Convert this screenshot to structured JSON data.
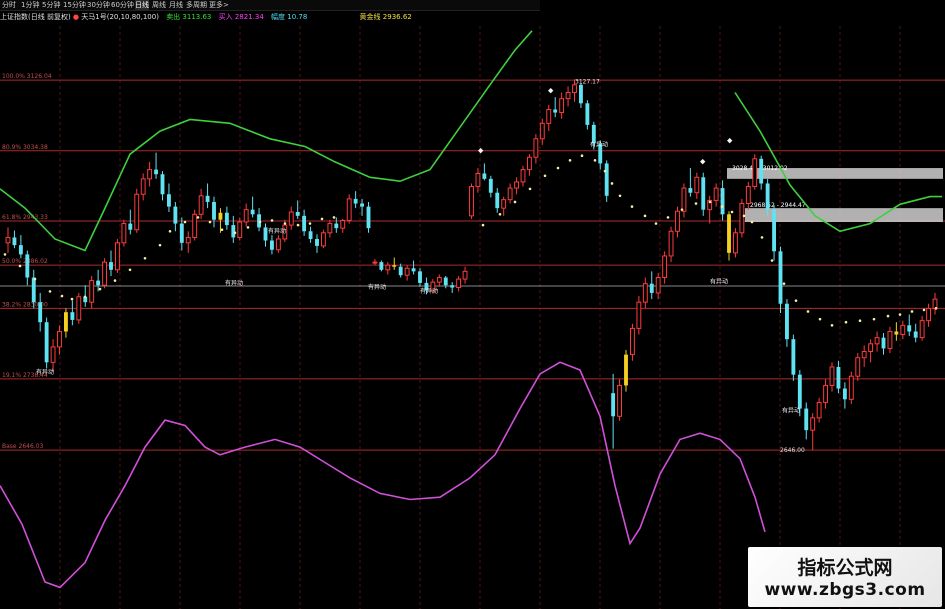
{
  "toolbar": {
    "tabs": [
      "分时",
      "1分钟",
      "5分钟",
      "15分钟",
      "30分钟",
      "60分钟",
      "日线",
      "周线",
      "月线",
      "多周期",
      "更多>"
    ],
    "active": "日线"
  },
  "legend": {
    "instrument": "上证指数(日线 前复权)",
    "indicator": "天马1号(20,10,80,100)",
    "sell_label": "卖出",
    "sell_value": "3113.63",
    "buy_label": "买入",
    "buy_value": "2821.34",
    "amp_label": "幅度",
    "amp_value": "10.78",
    "gold_label": "黄金线",
    "gold_value": "2936.62"
  },
  "levels": [
    {
      "label": "100.0% 3126.04",
      "value": 3126.04
    },
    {
      "label": "80.9% 3034.38",
      "value": 3034.38
    },
    {
      "label": "61.8% 2943.33",
      "value": 2943.33
    },
    {
      "label": "50.0% 2886.02",
      "value": 2886.02
    },
    {
      "label": "38.2% 2830.00",
      "value": 2830.0
    },
    {
      "label": "19.1% 2738.44",
      "value": 2738.44
    },
    {
      "label": "Base 2646.03",
      "value": 2646.03
    }
  ],
  "annotations": {
    "high": "3127.17",
    "low": "2646.00",
    "box_upper": "3028.46 - 3012.02",
    "box_lower": "2968.52 - 2944.47",
    "signal": "有异动"
  },
  "watermark": {
    "title": "指标公式网",
    "url": "www.zbgs3.com"
  },
  "colors": {
    "up": "#ff3b3b",
    "down": "#5fe3f2",
    "flag": "#f5d020",
    "green_band": "#3fcf3f",
    "purple_band": "#d050d8",
    "dots": "#f5f0a0",
    "level": "#c03030",
    "box": "#d0d0d0"
  },
  "chart_data": {
    "type": "candlestick",
    "candles": [
      [
        2915,
        2935,
        2902,
        2922
      ],
      [
        2922,
        2931,
        2908,
        2912
      ],
      [
        2912,
        2925,
        2895,
        2900
      ],
      [
        2900,
        2905,
        2860,
        2870
      ],
      [
        2870,
        2880,
        2830,
        2838
      ],
      [
        2838,
        2850,
        2800,
        2812
      ],
      [
        2812,
        2818,
        2752,
        2760
      ],
      [
        2760,
        2790,
        2748,
        2780
      ],
      [
        2780,
        2808,
        2770,
        2800
      ],
      [
        2800,
        2830,
        2792,
        2825
      ],
      [
        2825,
        2840,
        2808,
        2815
      ],
      [
        2815,
        2850,
        2810,
        2845
      ],
      [
        2845,
        2860,
        2832,
        2838
      ],
      [
        2838,
        2872,
        2830,
        2866
      ],
      [
        2866,
        2880,
        2852,
        2860
      ],
      [
        2860,
        2895,
        2856,
        2890
      ],
      [
        2890,
        2905,
        2872,
        2880
      ],
      [
        2880,
        2920,
        2876,
        2915
      ],
      [
        2915,
        2945,
        2910,
        2940
      ],
      [
        2940,
        2958,
        2926,
        2932
      ],
      [
        2932,
        2985,
        2928,
        2978
      ],
      [
        2978,
        3005,
        2970,
        2998
      ],
      [
        2998,
        3020,
        2988,
        3010
      ],
      [
        3010,
        3032,
        2998,
        3004
      ],
      [
        3004,
        3008,
        2970,
        2978
      ],
      [
        2978,
        2992,
        2955,
        2962
      ],
      [
        2962,
        2968,
        2930,
        2940
      ],
      [
        2940,
        2948,
        2905,
        2915
      ],
      [
        2915,
        2930,
        2902,
        2922
      ],
      [
        2922,
        2958,
        2918,
        2952
      ],
      [
        2952,
        2985,
        2946,
        2976
      ],
      [
        2976,
        2992,
        2960,
        2968
      ],
      [
        2968,
        2975,
        2935,
        2945
      ],
      [
        2945,
        2960,
        2928,
        2954
      ],
      [
        2954,
        2962,
        2932,
        2938
      ],
      [
        2938,
        2950,
        2915,
        2922
      ],
      [
        2922,
        2948,
        2918,
        2942
      ],
      [
        2942,
        2966,
        2936,
        2958
      ],
      [
        2958,
        2975,
        2948,
        2952
      ],
      [
        2952,
        2960,
        2930,
        2935
      ],
      [
        2935,
        2940,
        2910,
        2918
      ],
      [
        2918,
        2925,
        2900,
        2906
      ],
      [
        2906,
        2925,
        2902,
        2920
      ],
      [
        2920,
        2945,
        2916,
        2938
      ],
      [
        2938,
        2962,
        2932,
        2955
      ],
      [
        2955,
        2970,
        2946,
        2950
      ],
      [
        2950,
        2958,
        2924,
        2930
      ],
      [
        2930,
        2936,
        2915,
        2920
      ],
      [
        2920,
        2926,
        2902,
        2911
      ],
      [
        2911,
        2932,
        2908,
        2928
      ],
      [
        2928,
        2945,
        2922,
        2940
      ],
      [
        2940,
        2948,
        2928,
        2934
      ],
      [
        2934,
        2946,
        2928,
        2944
      ],
      [
        2944,
        2978,
        2940,
        2972
      ],
      [
        2972,
        2982,
        2960,
        2966
      ],
      [
        2966,
        2972,
        2950,
        2962
      ],
      [
        2962,
        2968,
        2928,
        2934
      ],
      [
        2890,
        2894,
        2886,
        2890
      ],
      [
        2890,
        2892,
        2878,
        2880
      ],
      [
        2880,
        2890,
        2874,
        2886
      ],
      [
        2886,
        2896,
        2880,
        2884
      ],
      [
        2884,
        2888,
        2870,
        2873
      ],
      [
        2873,
        2886,
        2866,
        2882
      ],
      [
        2882,
        2892,
        2874,
        2878
      ],
      [
        2878,
        2882,
        2858,
        2863
      ],
      [
        2863,
        2870,
        2848,
        2853
      ],
      [
        2853,
        2868,
        2849,
        2864
      ],
      [
        2864,
        2874,
        2858,
        2870
      ],
      [
        2870,
        2872,
        2856,
        2860
      ],
      [
        2860,
        2864,
        2850,
        2857
      ],
      [
        2857,
        2872,
        2852,
        2868
      ],
      [
        2868,
        2884,
        2862,
        2878
      ],
      [
        2950,
        2992,
        2946,
        2988
      ],
      [
        2988,
        3012,
        2980,
        3005
      ],
      [
        3005,
        3018,
        2996,
        2998
      ],
      [
        2998,
        3002,
        2974,
        2980
      ],
      [
        2980,
        2986,
        2954,
        2960
      ],
      [
        2960,
        2975,
        2950,
        2971
      ],
      [
        2971,
        2992,
        2966,
        2986
      ],
      [
        2986,
        3000,
        2978,
        2994
      ],
      [
        2994,
        3015,
        2988,
        3010
      ],
      [
        3010,
        3030,
        3002,
        3026
      ],
      [
        3026,
        3056,
        3018,
        3050
      ],
      [
        3050,
        3076,
        3042,
        3070
      ],
      [
        3070,
        3094,
        3060,
        3088
      ],
      [
        3088,
        3104,
        3078,
        3084
      ],
      [
        3084,
        3110,
        3076,
        3102
      ],
      [
        3102,
        3118,
        3092,
        3110
      ],
      [
        3110,
        3127,
        3098,
        3120
      ],
      [
        3120,
        3122,
        3090,
        3096
      ],
      [
        3096,
        3100,
        3062,
        3068
      ],
      [
        3068,
        3072,
        3036,
        3044
      ],
      [
        3044,
        3048,
        3010,
        3018
      ],
      [
        3018,
        3022,
        2968,
        2976
      ],
      [
        2720,
        2745,
        2648,
        2690
      ],
      [
        2690,
        2738,
        2684,
        2730
      ],
      [
        2730,
        2776,
        2722,
        2770
      ],
      [
        2770,
        2810,
        2762,
        2804
      ],
      [
        2804,
        2846,
        2796,
        2838
      ],
      [
        2838,
        2870,
        2830,
        2862
      ],
      [
        2862,
        2878,
        2842,
        2850
      ],
      [
        2850,
        2876,
        2842,
        2870
      ],
      [
        2870,
        2904,
        2862,
        2898
      ],
      [
        2898,
        2936,
        2890,
        2930
      ],
      [
        2930,
        2962,
        2922,
        2956
      ],
      [
        2956,
        2992,
        2948,
        2986
      ],
      [
        2986,
        3012,
        2975,
        2980
      ],
      [
        2980,
        3006,
        2972,
        3000
      ],
      [
        3000,
        3006,
        2950,
        2958
      ],
      [
        2958,
        2976,
        2940,
        2970
      ],
      [
        2970,
        2992,
        2962,
        2986
      ],
      [
        2986,
        2996,
        2944,
        2952
      ],
      [
        2952,
        2956,
        2892,
        2902
      ],
      [
        2902,
        2934,
        2896,
        2928
      ],
      [
        2928,
        2972,
        2922,
        2966
      ],
      [
        2966,
        2994,
        2958,
        2988
      ],
      [
        2988,
        3030,
        2984,
        3024
      ],
      [
        3024,
        3028,
        2984,
        2992
      ],
      [
        2992,
        2998,
        2950,
        2958
      ],
      [
        2958,
        2964,
        2892,
        2904
      ],
      [
        2904,
        2910,
        2824,
        2836
      ],
      [
        2836,
        2842,
        2780,
        2790
      ],
      [
        2790,
        2796,
        2736,
        2744
      ],
      [
        2744,
        2750,
        2690,
        2700
      ],
      [
        2700,
        2708,
        2660,
        2672
      ],
      [
        2672,
        2694,
        2646,
        2688
      ],
      [
        2688,
        2714,
        2682,
        2708
      ],
      [
        2708,
        2738,
        2700,
        2730
      ],
      [
        2730,
        2760,
        2722,
        2754
      ],
      [
        2754,
        2762,
        2720,
        2726
      ],
      [
        2726,
        2734,
        2700,
        2712
      ],
      [
        2712,
        2748,
        2706,
        2742
      ],
      [
        2742,
        2772,
        2736,
        2766
      ],
      [
        2766,
        2782,
        2754,
        2774
      ],
      [
        2774,
        2790,
        2760,
        2784
      ],
      [
        2784,
        2800,
        2774,
        2792
      ],
      [
        2792,
        2798,
        2770,
        2778
      ],
      [
        2778,
        2806,
        2772,
        2800
      ],
      [
        2800,
        2812,
        2788,
        2796
      ],
      [
        2796,
        2814,
        2790,
        2808
      ],
      [
        2808,
        2822,
        2794,
        2800
      ],
      [
        2800,
        2810,
        2786,
        2792
      ],
      [
        2792,
        2820,
        2788,
        2814
      ],
      [
        2814,
        2836,
        2806,
        2830
      ],
      [
        2830,
        2850,
        2822,
        2842
      ]
    ],
    "green_band": [
      [
        0,
        2985
      ],
      [
        25,
        2960
      ],
      [
        55,
        2920
      ],
      [
        85,
        2905
      ],
      [
        105,
        2960
      ],
      [
        130,
        3030
      ],
      [
        160,
        3060
      ],
      [
        190,
        3075
      ],
      [
        230,
        3070
      ],
      [
        270,
        3050
      ],
      [
        305,
        3040
      ],
      [
        335,
        3020
      ],
      [
        370,
        3000
      ],
      [
        400,
        2995
      ],
      [
        430,
        3010
      ],
      [
        460,
        3065
      ],
      [
        490,
        3120
      ],
      [
        515,
        3165
      ],
      [
        532,
        3190
      ],
      [
        735,
        3110
      ],
      [
        760,
        3060
      ],
      [
        790,
        2990
      ],
      [
        815,
        2950
      ],
      [
        840,
        2930
      ],
      [
        870,
        2940
      ],
      [
        900,
        2965
      ],
      [
        930,
        2975
      ],
      [
        942,
        2975
      ]
    ],
    "purple_band": [
      [
        0,
        2600
      ],
      [
        22,
        2550
      ],
      [
        45,
        2475
      ],
      [
        60,
        2468
      ],
      [
        85,
        2500
      ],
      [
        105,
        2555
      ],
      [
        125,
        2600
      ],
      [
        145,
        2650
      ],
      [
        165,
        2685
      ],
      [
        185,
        2678
      ],
      [
        205,
        2650
      ],
      [
        220,
        2640
      ],
      [
        245,
        2650
      ],
      [
        275,
        2660
      ],
      [
        300,
        2650
      ],
      [
        325,
        2630
      ],
      [
        350,
        2610
      ],
      [
        380,
        2590
      ],
      [
        410,
        2582
      ],
      [
        440,
        2585
      ],
      [
        470,
        2610
      ],
      [
        495,
        2640
      ],
      [
        520,
        2700
      ],
      [
        540,
        2745
      ],
      [
        560,
        2760
      ],
      [
        580,
        2750
      ],
      [
        600,
        2690
      ],
      [
        615,
        2600
      ],
      [
        630,
        2525
      ],
      [
        640,
        2545
      ],
      [
        660,
        2615
      ],
      [
        680,
        2660
      ],
      [
        700,
        2668
      ],
      [
        720,
        2660
      ],
      [
        740,
        2635
      ],
      [
        755,
        2585
      ],
      [
        765,
        2540
      ]
    ],
    "dots_series": [
      [
        5,
        2900
      ],
      [
        20,
        2885
      ],
      [
        35,
        2868
      ],
      [
        50,
        2852
      ],
      [
        62,
        2846
      ],
      [
        72,
        2842
      ],
      [
        85,
        2845
      ],
      [
        100,
        2855
      ],
      [
        115,
        2866
      ],
      [
        130,
        2880
      ],
      [
        145,
        2895
      ],
      [
        160,
        2912
      ],
      [
        170,
        2930
      ],
      [
        185,
        2942
      ],
      [
        198,
        2948
      ],
      [
        210,
        2942
      ],
      [
        222,
        2932
      ],
      [
        235,
        2928
      ],
      [
        248,
        2935
      ],
      [
        260,
        2942
      ],
      [
        272,
        2944
      ],
      [
        285,
        2940
      ],
      [
        298,
        2938
      ],
      [
        310,
        2940
      ],
      [
        322,
        2946
      ],
      [
        334,
        2948
      ],
      [
        483,
        2938
      ],
      [
        500,
        2952
      ],
      [
        515,
        2968
      ],
      [
        530,
        2985
      ],
      [
        545,
        3002
      ],
      [
        558,
        3012
      ],
      [
        570,
        3022
      ],
      [
        582,
        3028
      ],
      [
        595,
        3022
      ],
      [
        605,
        3008
      ],
      [
        612,
        2992
      ],
      [
        620,
        2976
      ],
      [
        632,
        2962
      ],
      [
        645,
        2950
      ],
      [
        656,
        2940
      ],
      [
        668,
        2948
      ],
      [
        682,
        2958
      ],
      [
        696,
        2966
      ],
      [
        710,
        2968
      ],
      [
        722,
        2962
      ],
      [
        732,
        2955
      ],
      [
        744,
        2950
      ],
      [
        752,
        2942
      ],
      [
        762,
        2922
      ],
      [
        772,
        2892
      ],
      [
        784,
        2862
      ],
      [
        796,
        2840
      ],
      [
        808,
        2826
      ],
      [
        820,
        2816
      ],
      [
        832,
        2808
      ],
      [
        846,
        2812
      ],
      [
        860,
        2814
      ],
      [
        874,
        2816
      ],
      [
        888,
        2820
      ],
      [
        900,
        2822
      ],
      [
        912,
        2826
      ],
      [
        924,
        2828
      ],
      [
        936,
        2830
      ]
    ],
    "x_range": [
      0,
      945
    ],
    "y_range": [
      2440,
      3230
    ]
  }
}
